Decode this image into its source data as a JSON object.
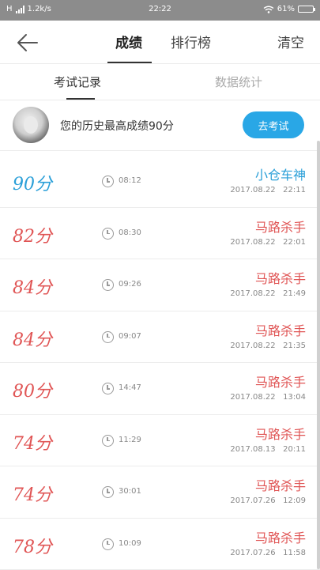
{
  "status_bar": {
    "network": "H",
    "speed": "1.2k/s",
    "time": "22:22",
    "battery": "61%",
    "battery_level": 0.61
  },
  "header": {
    "tabs": [
      "成绩",
      "排行榜"
    ],
    "active_tab": 0,
    "clear_label": "清空"
  },
  "subtabs": {
    "items": [
      "考试记录",
      "数据统计"
    ],
    "active": 0
  },
  "best": {
    "text": "您的历史最高成绩90分",
    "button_label": "去考试"
  },
  "colors": {
    "accent": "#29a7e6",
    "high_score": "#2a9fd8",
    "low_score": "#e05555"
  },
  "records": [
    {
      "score": "90分",
      "duration": "08:12",
      "title": "小仓车神",
      "date": "2017.08.22   22:11",
      "level": "high"
    },
    {
      "score": "82分",
      "duration": "08:30",
      "title": "马路杀手",
      "date": "2017.08.22   22:01",
      "level": "low"
    },
    {
      "score": "84分",
      "duration": "09:26",
      "title": "马路杀手",
      "date": "2017.08.22   21:49",
      "level": "low"
    },
    {
      "score": "84分",
      "duration": "09:07",
      "title": "马路杀手",
      "date": "2017.08.22   21:35",
      "level": "low"
    },
    {
      "score": "80分",
      "duration": "14:47",
      "title": "马路杀手",
      "date": "2017.08.22   13:04",
      "level": "low"
    },
    {
      "score": "74分",
      "duration": "11:29",
      "title": "马路杀手",
      "date": "2017.08.13   20:11",
      "level": "low"
    },
    {
      "score": "74分",
      "duration": "30:01",
      "title": "马路杀手",
      "date": "2017.07.26   12:09",
      "level": "low"
    },
    {
      "score": "78分",
      "duration": "10:09",
      "title": "马路杀手",
      "date": "2017.07.26   11:58",
      "level": "low"
    }
  ]
}
